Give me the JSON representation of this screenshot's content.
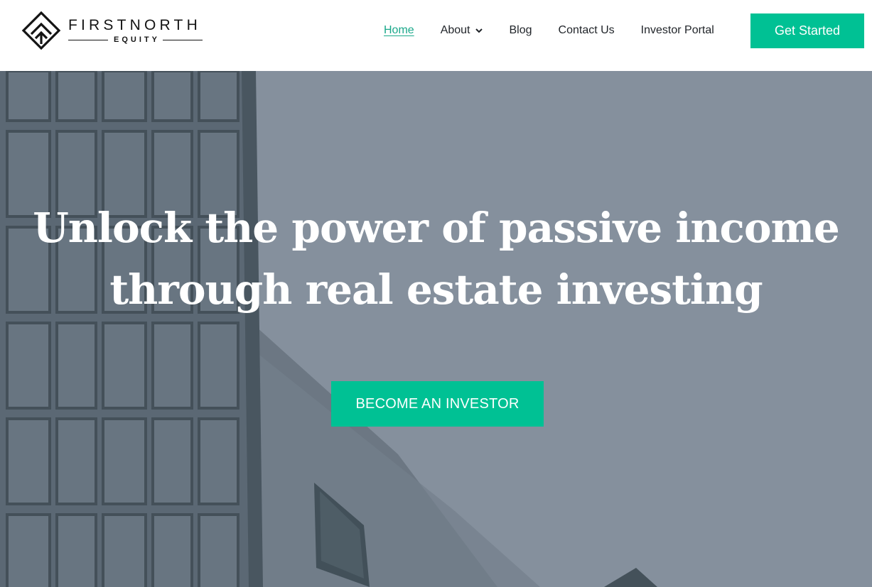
{
  "brand": {
    "name": "FIRSTNORTH",
    "sub": "EQUITY",
    "color": "#141414"
  },
  "nav": {
    "items": [
      {
        "label": "Home",
        "active": true
      },
      {
        "label": "About",
        "has_dropdown": true
      },
      {
        "label": "Blog"
      },
      {
        "label": "Contact Us"
      },
      {
        "label": "Investor Portal"
      }
    ],
    "cta_label": "Get Started"
  },
  "hero": {
    "title": "Unlock the power of passive income through real estate investing",
    "button_label": "BECOME AN INVESTOR"
  },
  "colors": {
    "accent": "#00c194",
    "active_link": "#1aa88a",
    "hero_overlay": "#7e8a97"
  },
  "icons": {
    "logo": "diamond-chevron-logo-icon",
    "dropdown": "chevron-down-icon"
  }
}
